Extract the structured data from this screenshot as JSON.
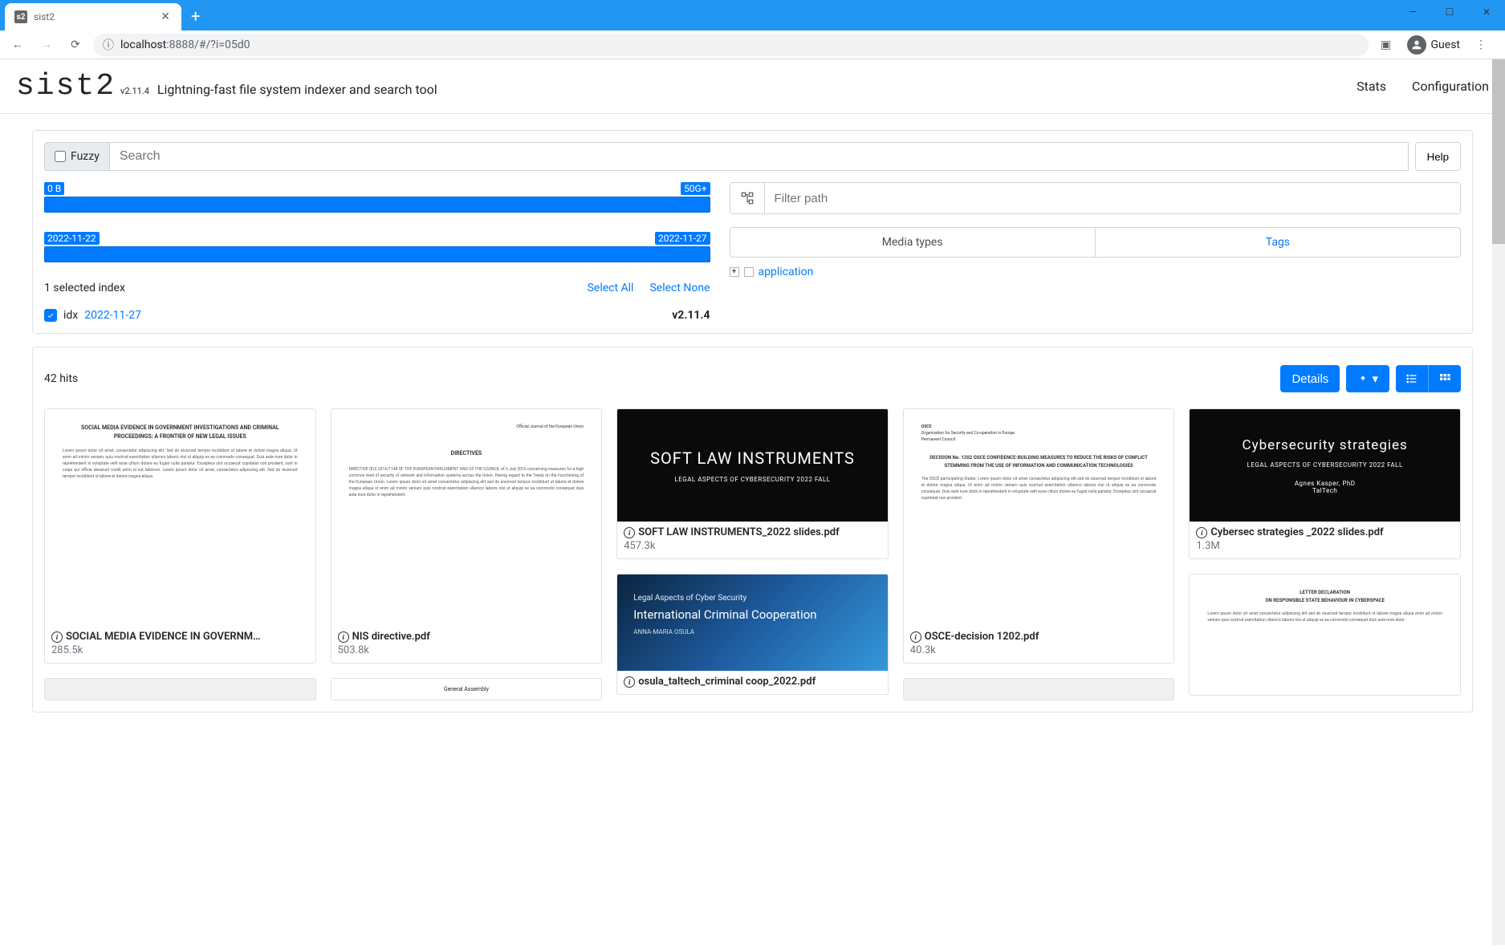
{
  "browser": {
    "tab_favicon": "s2",
    "tab_title": "sist2",
    "url_prefix_icon": "ⓘ",
    "url_host": "localhost",
    "url_port_path": ":8888/#/?i=05d0",
    "guest_label": "Guest"
  },
  "header": {
    "logo": "sist2",
    "version": "v2.11.4",
    "tagline": "Lightning-fast file system indexer and search tool",
    "nav": {
      "stats": "Stats",
      "config": "Configuration"
    }
  },
  "search": {
    "fuzzy_label": "Fuzzy",
    "placeholder": "Search",
    "help": "Help"
  },
  "size_slider": {
    "min": "0 B",
    "max": "50G+"
  },
  "date_slider": {
    "min": "2022-11-22",
    "max": "2022-11-27"
  },
  "index": {
    "selected_text": "1 selected index",
    "select_all": "Select All",
    "select_none": "Select None",
    "name": "idx",
    "date": "2022-11-27",
    "version": "v2.11.4"
  },
  "path_filter": {
    "placeholder": "Filter path"
  },
  "type_tabs": {
    "media": "Media types",
    "tags": "Tags"
  },
  "type_tree": {
    "application": "application"
  },
  "results": {
    "hits": "42 hits",
    "details": "Details",
    "items": [
      {
        "title": "SOCIAL MEDIA EVIDENCE IN GOVERNM…",
        "size": "285.5k",
        "thumb_head": "SOCIAL MEDIA EVIDENCE IN GOVERNMENT INVESTIGATIONS AND CRIMINAL PROCEEDINGS: A FRONTIER OF NEW LEGAL ISSUES"
      },
      {
        "title": "NIS directive.pdf",
        "size": "503.8k",
        "thumb_head": "DIRECTIVES"
      },
      {
        "title": "SOFT LAW INSTRUMENTS_2022 slides.pdf",
        "size": "457.3k",
        "thumb_big": "SOFT LAW INSTRUMENTS",
        "thumb_sub": "LEGAL ASPECTS OF CYBERSECURITY 2022 FALL"
      },
      {
        "title": "osula_taltech_criminal coop_2022.pdf",
        "thumb_sub": "Legal Aspects of Cyber Security",
        "thumb_big": "International Criminal Cooperation",
        "thumb_auth": "ANNA-MARIA OSULA"
      },
      {
        "title": "OSCE-decision 1202.pdf",
        "size": "40.3k",
        "thumb_head": "DECISION No. 1202 OSCE CONFIDENCE-BUILDING MEASURES TO REDUCE THE RISKS OF CONFLICT STEMMING FROM THE USE OF INFORMATION AND COMMUNICATION TECHNOLOGIES"
      },
      {
        "title": "Cybersec strategies _2022 slides.pdf",
        "size": "1.3M",
        "thumb_big": "Cybersecurity strategies",
        "thumb_sub": "LEGAL ASPECTS OF CYBERSECURITY 2022 FALL",
        "thumb_auth": "Agnes Kasper, PhD\nTalTech"
      }
    ]
  }
}
